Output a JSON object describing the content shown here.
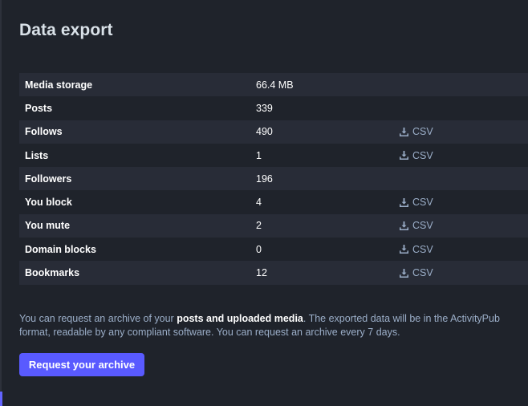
{
  "page": {
    "title": "Data export"
  },
  "export_table": {
    "rows": [
      {
        "label": "Media storage",
        "value": "66.4 MB",
        "action": ""
      },
      {
        "label": "Posts",
        "value": "339",
        "action": ""
      },
      {
        "label": "Follows",
        "value": "490",
        "action": "CSV"
      },
      {
        "label": "Lists",
        "value": "1",
        "action": "CSV"
      },
      {
        "label": "Followers",
        "value": "196",
        "action": ""
      },
      {
        "label": "You block",
        "value": "4",
        "action": "CSV"
      },
      {
        "label": "You mute",
        "value": "2",
        "action": "CSV"
      },
      {
        "label": "Domain blocks",
        "value": "0",
        "action": "CSV"
      },
      {
        "label": "Bookmarks",
        "value": "12",
        "action": "CSV"
      }
    ],
    "download_icon": "download-icon"
  },
  "archive": {
    "text_before": "You can request an archive of your ",
    "text_bold": "posts and uploaded media",
    "text_after": ". The exported data will be in the ActivityPub format, readable by any compliant software. You can request an archive every 7 days.",
    "button_label": "Request your archive"
  },
  "colors": {
    "background": "#1f232b",
    "row_alt": "#282c37",
    "accent": "#595aff",
    "muted_text": "#9baec8"
  }
}
